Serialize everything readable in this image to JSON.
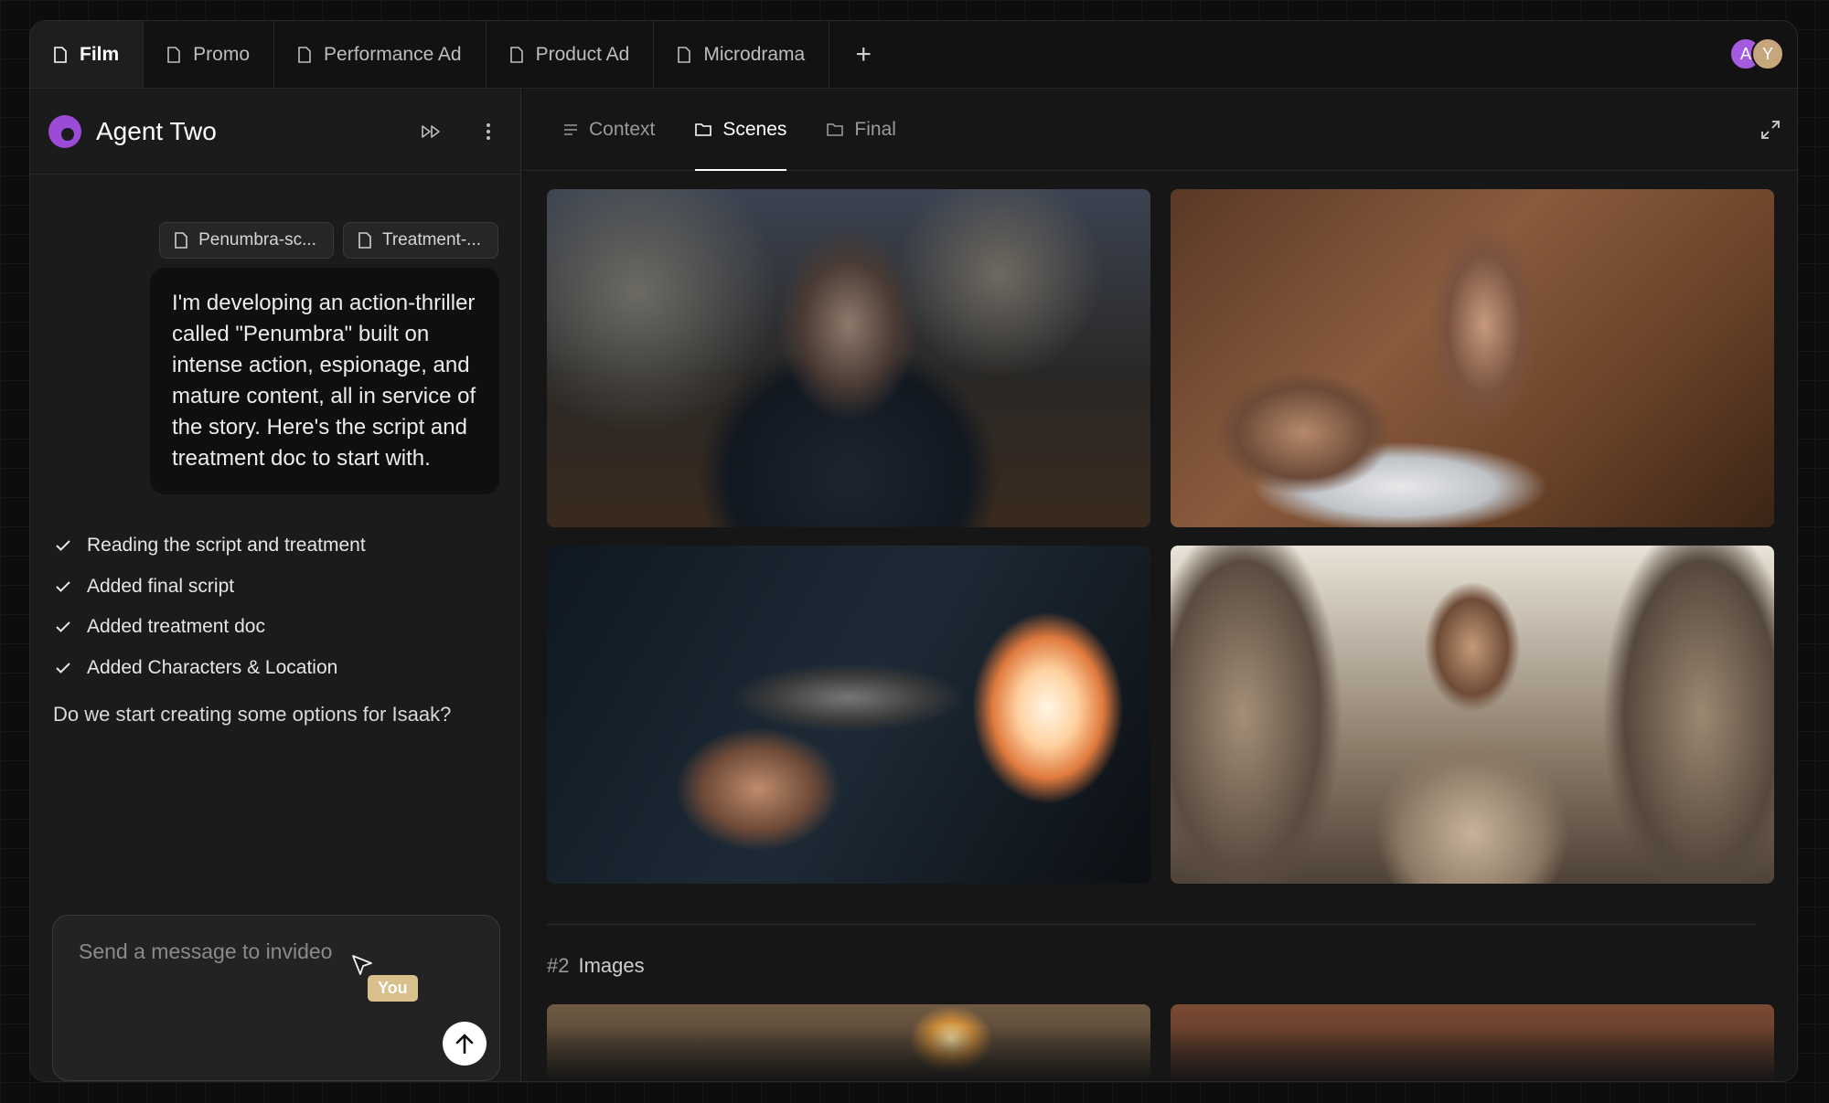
{
  "tabs": [
    {
      "label": "Film",
      "active": true
    },
    {
      "label": "Promo",
      "active": false
    },
    {
      "label": "Performance Ad",
      "active": false
    },
    {
      "label": "Product Ad",
      "active": false
    },
    {
      "label": "Microdrama",
      "active": false
    }
  ],
  "avatars": [
    {
      "initial": "A",
      "color": "#a45be0"
    },
    {
      "initial": "Y",
      "color": "#c6a67d"
    }
  ],
  "agent": {
    "name": "Agent Two"
  },
  "chat": {
    "attachments": [
      "Penumbra-sc...",
      "Treatment-..."
    ],
    "user_message": "I'm developing an action-thriller called \"Penumbra\" built on intense action, espionage, and mature content, all in service of the story. Here's the script and treatment doc to start with.",
    "steps": [
      "Reading the script and treatment",
      "Added final script",
      "Added treatment doc",
      "Added Characters & Location"
    ],
    "question": "Do we start creating some options for Isaak?"
  },
  "composer": {
    "placeholder": "Send a message to invideo",
    "cursor_tag": "You"
  },
  "right_tabs": [
    {
      "label": "Context",
      "active": false,
      "icon": "list-icon"
    },
    {
      "label": "Scenes",
      "active": true,
      "icon": "folder-icon"
    },
    {
      "label": "Final",
      "active": false,
      "icon": "folder-icon"
    }
  ],
  "section2": {
    "number": "#2",
    "title": "Images"
  },
  "colors": {
    "accent_purple": "#9a4bd8",
    "cursor_tag": "#d8bf8c"
  }
}
